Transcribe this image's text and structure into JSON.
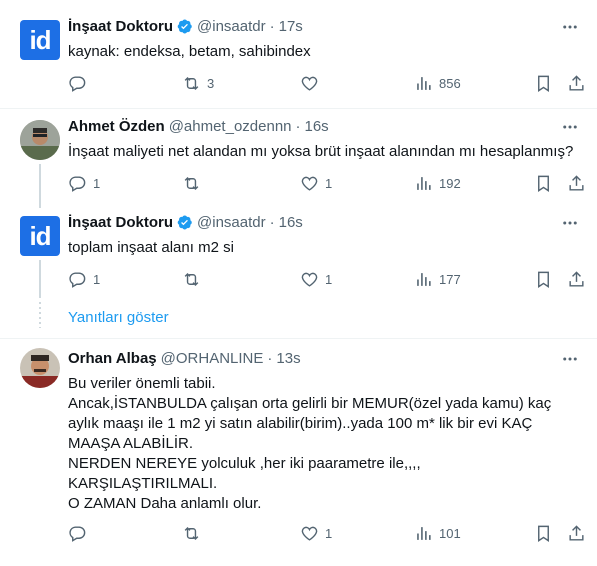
{
  "tweets": [
    {
      "name": "İnşaat Doktoru",
      "handle": "@insaatdr",
      "time": "17s",
      "text": "kaynak: endeksa, betam, sahibindex",
      "avatar_text": "id",
      "reply_count": "",
      "retweet_count": "3",
      "like_count": "",
      "view_count": "856"
    },
    {
      "name": "Ahmet Özden",
      "handle": "@ahmet_ozdennn",
      "time": "16s",
      "text": "İnşaat maliyeti net alandan mı yoksa brüt inşaat alanından mı hesaplanmış?",
      "reply_count": "1",
      "retweet_count": "",
      "like_count": "1",
      "view_count": "192"
    },
    {
      "name": "İnşaat Doktoru",
      "handle": "@insaatdr",
      "time": "16s",
      "text": "toplam inşaat alanı m2 si",
      "avatar_text": "id",
      "reply_count": "1",
      "retweet_count": "",
      "like_count": "1",
      "view_count": "177"
    },
    {
      "name": "Orhan Albaş",
      "handle": "@ORHANLINE",
      "time": "13s",
      "text": "Bu veriler önemli tabii.\nAncak,İSTANBULDA çalışan orta gelirli bir MEMUR(özel yada kamu) kaç aylık maaşı ile 1 m2 yi satın alabilir(birim)..yada 100 m* lik bir evi KAÇ MAAŞA ALABİLİR.\nNERDEN NEREYE yolculuk ,her iki paarametre ile,,,,\nKARŞILAŞTIRILMALI.\nO ZAMAN Daha anlamlı olur.",
      "reply_count": "",
      "retweet_count": "",
      "like_count": "1",
      "view_count": "101"
    }
  ],
  "show_replies_label": "Yanıtları göster",
  "colors": {
    "accent": "#1d9bf0",
    "muted": "#536471",
    "brand_id": "#1d6fe5"
  }
}
